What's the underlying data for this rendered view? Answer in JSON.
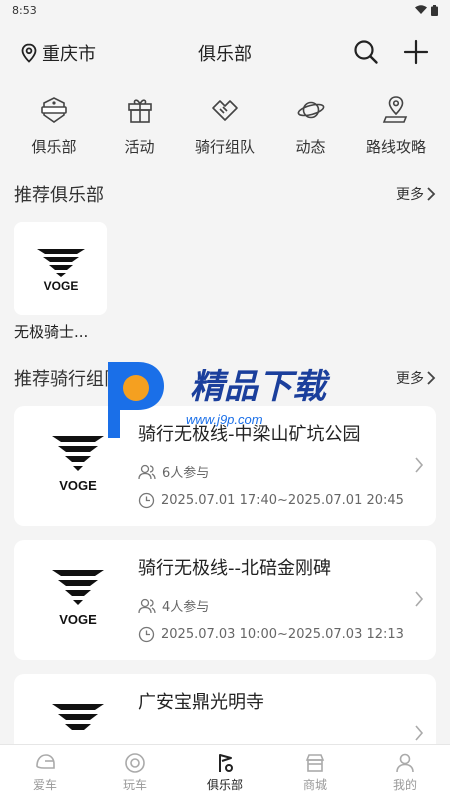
{
  "status": {
    "time": "8:53"
  },
  "header": {
    "city": "重庆市",
    "title": "俱乐部"
  },
  "grid": [
    {
      "label": "俱乐部",
      "icon": "badge-icon"
    },
    {
      "label": "活动",
      "icon": "gift-icon"
    },
    {
      "label": "骑行组队",
      "icon": "handshake-icon"
    },
    {
      "label": "动态",
      "icon": "planet-icon"
    },
    {
      "label": "路线攻略",
      "icon": "route-pin-icon"
    }
  ],
  "recommended_clubs": {
    "title": "推荐俱乐部",
    "more": "更多",
    "items": [
      {
        "name": "无极骑士...",
        "logo_text": "VOGE"
      }
    ]
  },
  "recommended_rides": {
    "title": "推荐骑行组队",
    "more": "更多",
    "items": [
      {
        "title": "骑行无极线-中梁山矿坑公园",
        "participants": "6人参与",
        "time": "2025.07.01 17:40~2025.07.01 20:45",
        "logo_text": "VOGE"
      },
      {
        "title": "骑行无极线--北碚金刚碑",
        "participants": "4人参与",
        "time": "2025.07.03 10:00~2025.07.03 12:13",
        "logo_text": "VOGE"
      },
      {
        "title": "广安宝鼎光明寺",
        "participants": "",
        "time": "",
        "logo_text": ""
      }
    ]
  },
  "watermark": {
    "brand": "精品下载",
    "url": "www.j9p.com"
  },
  "tabbar": [
    {
      "label": "爱车",
      "active": false
    },
    {
      "label": "玩车",
      "active": false
    },
    {
      "label": "俱乐部",
      "active": true
    },
    {
      "label": "商城",
      "active": false
    },
    {
      "label": "我的",
      "active": false
    }
  ],
  "colors": {
    "accent": "#222222",
    "watermark_blue": "#1a6fe8",
    "watermark_orange": "#f5a020"
  }
}
